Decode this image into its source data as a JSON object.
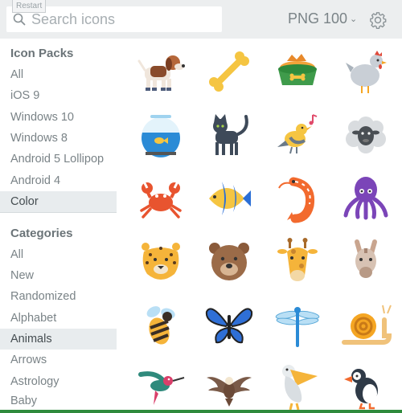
{
  "topbar": {
    "restart_label": "Restart",
    "search_placeholder": "Search icons",
    "format_label": "PNG 100",
    "format_chevron": "⌄"
  },
  "sidebar": {
    "icon_packs_heading": "Icon Packs",
    "icon_packs": [
      {
        "label": "All",
        "active": false
      },
      {
        "label": "iOS 9",
        "active": false
      },
      {
        "label": "Windows 10",
        "active": false
      },
      {
        "label": "Windows 8",
        "active": false
      },
      {
        "label": "Android 5 Lollipop",
        "active": false
      },
      {
        "label": "Android 4",
        "active": false
      },
      {
        "label": "Color",
        "active": true
      }
    ],
    "categories_heading": "Categories",
    "categories": [
      {
        "label": "All",
        "active": false
      },
      {
        "label": "New",
        "active": false
      },
      {
        "label": "Randomized",
        "active": false
      },
      {
        "label": "Alphabet",
        "active": false
      },
      {
        "label": "Animals",
        "active": true
      },
      {
        "label": "Arrows",
        "active": false
      },
      {
        "label": "Astrology",
        "active": false
      },
      {
        "label": "Baby",
        "active": false
      }
    ]
  },
  "icons": [
    "dog-icon",
    "bone-icon",
    "dog-bowl-icon",
    "chicken-icon",
    "fish-bowl-icon",
    "cat-icon",
    "singing-bird-icon",
    "sheep-icon",
    "crab-icon",
    "tropical-fish-icon",
    "shrimp-icon",
    "octopus-icon",
    "leopard-icon",
    "bear-icon",
    "giraffe-icon",
    "llama-icon",
    "bee-icon",
    "butterfly-icon",
    "dragonfly-icon",
    "snail-icon",
    "hummingbird-icon",
    "eagle-icon",
    "pelican-icon",
    "puffin-icon"
  ],
  "colors": {
    "accent_green": "#2f8a3c",
    "active_bg": "#e8ecee",
    "topbar_bg": "#eceeef"
  }
}
